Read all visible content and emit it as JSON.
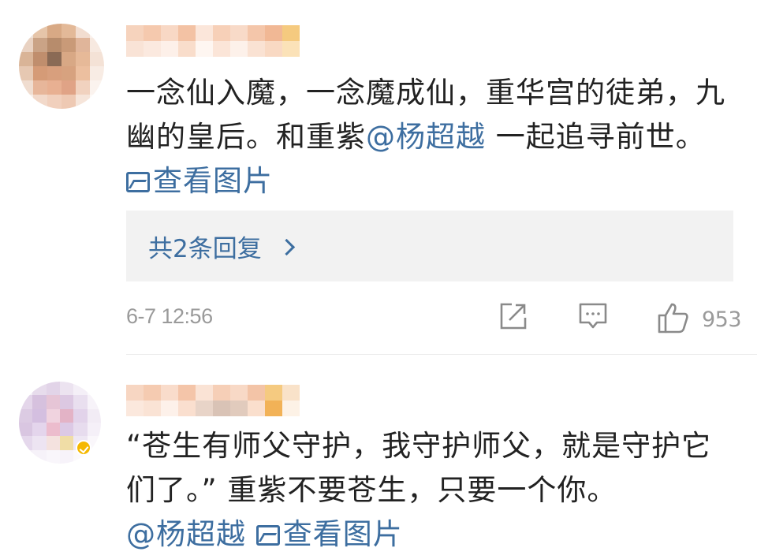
{
  "comments": [
    {
      "text_before": "一念仙入魔，一念魔成仙，重华宫的徒弟，九幽的皇后。和重紫",
      "mention": "@杨超越",
      "text_after": " 一起追寻前世。 ",
      "view_image": "查看图片",
      "replies_label": "共2条回复",
      "timestamp": "6-7 12:56",
      "like_count": "953"
    },
    {
      "text_before": "“苍生有师父守护，我守护师父，就是守护它们了。” 重紫不要苍生，只要一个你。",
      "mention": "@杨超越",
      "text_after": " ",
      "view_image": "查看图片"
    }
  ],
  "colors": {
    "link": "#3d6ea0",
    "meta": "#9a9a9a",
    "reply_bg": "#f2f2f2",
    "verified_badge": "#f5b800"
  },
  "icons": [
    "share-icon",
    "comment-icon",
    "like-icon",
    "image-icon",
    "chevron-right-icon",
    "verified-badge-icon"
  ]
}
